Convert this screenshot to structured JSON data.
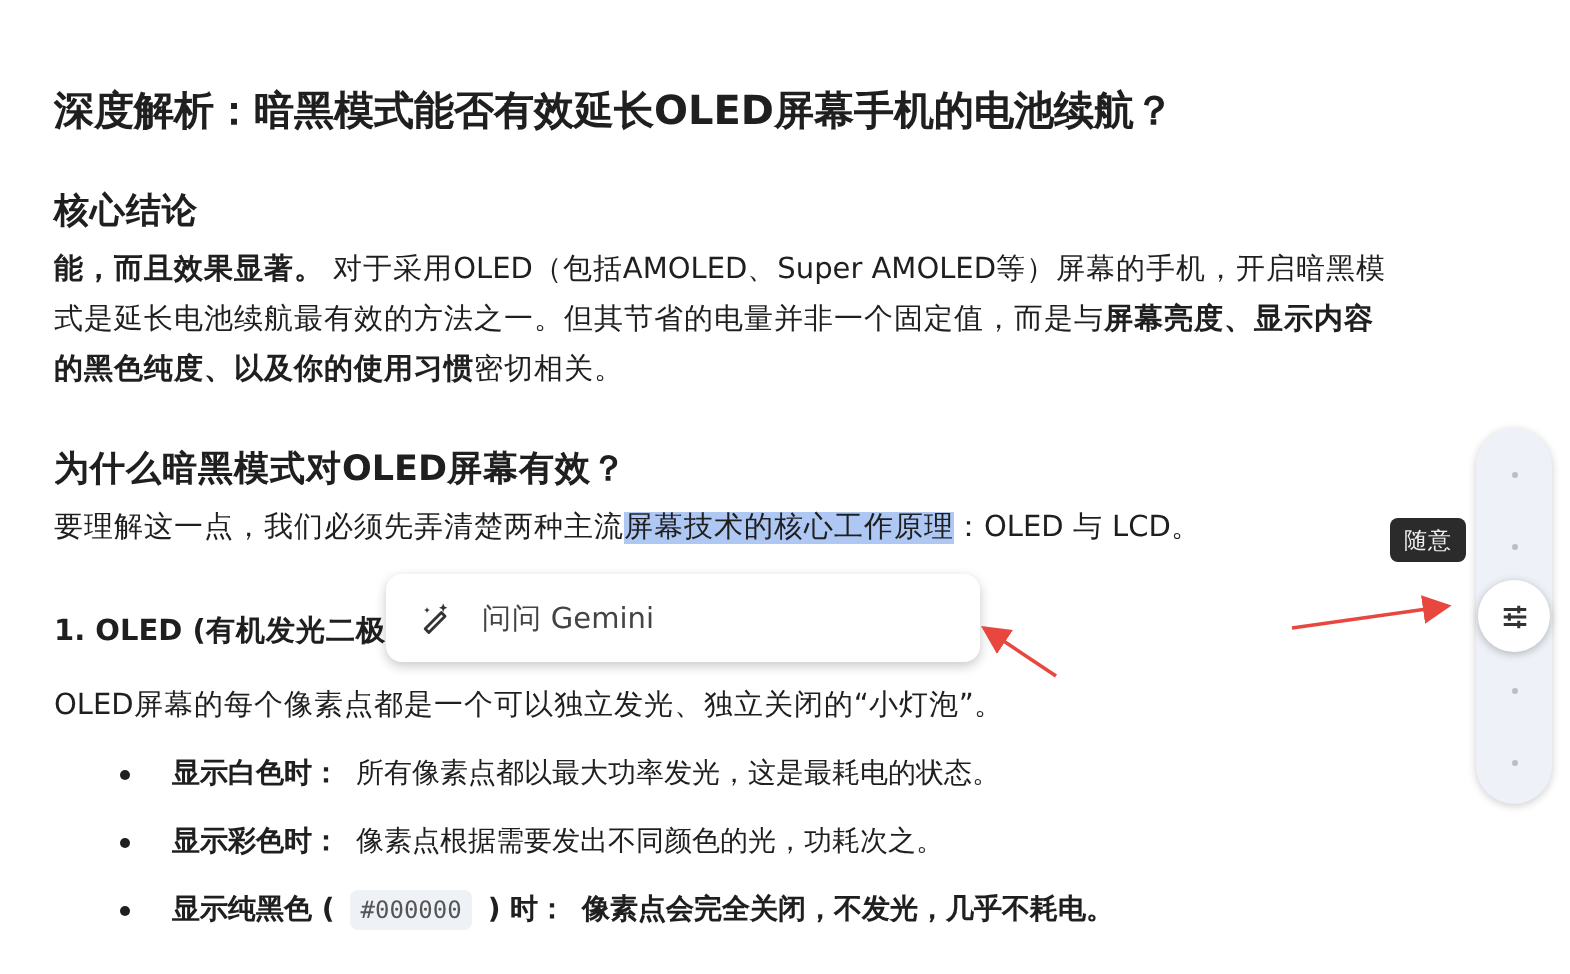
{
  "title": "深度解析：暗黑模式能否有效延长OLED屏幕手机的电池续航？",
  "sections": [
    {
      "heading": "核心结论",
      "paragraphs": [
        [
          {
            "text": "**能，而且效果显著。** 对于采用OLED（包括AMOLED、Super AMOLED等）屏幕的手机，开启暗黑模式是延长电池续航最有效的方法之一。但其节省的电量并非一个固定值，而是与**屏幕亮度、显示内容的黑色纯度、以及你的使用习惯**密切相关。",
            "highlighted": false
          }
        ]
      ]
    },
    {
      "heading": "为什么暗黑模式对OLED屏幕有效？",
      "paragraphs": [
        [
          {
            "text": "要理解这一点，我们必须先弄清楚两种主流",
            "highlighted": false
          },
          {
            "text": "屏幕技术的核心工作原理",
            "highlighted": true
          },
          {
            "text": "：OLED 与 LCD。",
            "highlighted": false
          }
        ]
      ]
    }
  ],
  "subheading": "1. OLED (有机发光二极",
  "intro": "OLED屏幕的每个像素点都是一个可以独立发光、独立关闭的“小灯泡”。",
  "bullets": [
    [
      {
        "kind": "bold",
        "text": "显示白色时："
      },
      {
        "kind": "plain",
        "text": "所有像素点都以最大功率发光，这是最耗电的状态。"
      }
    ],
    [
      {
        "kind": "bold",
        "text": "显示彩色时："
      },
      {
        "kind": "plain",
        "text": "像素点根据需要发出不同颜色的光，功耗次之。"
      }
    ],
    [
      {
        "kind": "bold",
        "text": "显示纯黑色 ("
      },
      {
        "kind": "code",
        "text": "#000000"
      },
      {
        "kind": "bold",
        "text": ") 时："
      },
      {
        "kind": "bold",
        "text": "像素点会完全关闭，不发光，几乎不耗电。"
      }
    ]
  ],
  "popup": {
    "label": "问问 Gemini"
  },
  "slider": {
    "tooltip": "随意",
    "level": 0.5
  }
}
